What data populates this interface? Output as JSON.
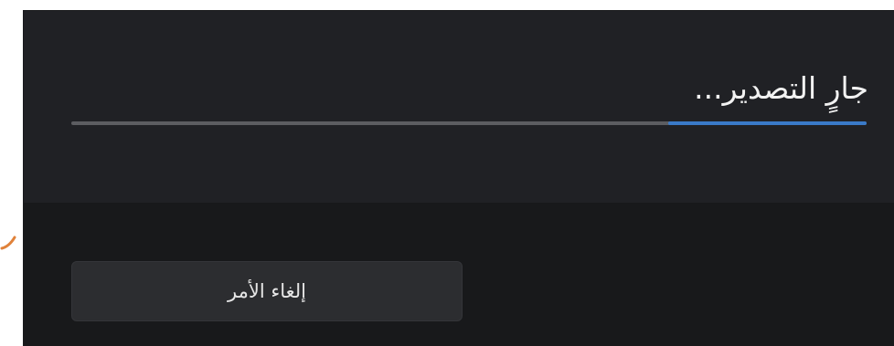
{
  "dialog": {
    "title": "جارٍ التصدير...",
    "progress": {
      "fraction": 0.25,
      "fill_color": "#3a7ac8",
      "track_color": "#5c5d61"
    },
    "cancel_button_label": "إلغاء الأمر"
  },
  "colors": {
    "dialog_background": "#202125",
    "footer_background": "#18191b",
    "button_background": "#2c2d30",
    "annotation_arrow": "#e0823a"
  }
}
